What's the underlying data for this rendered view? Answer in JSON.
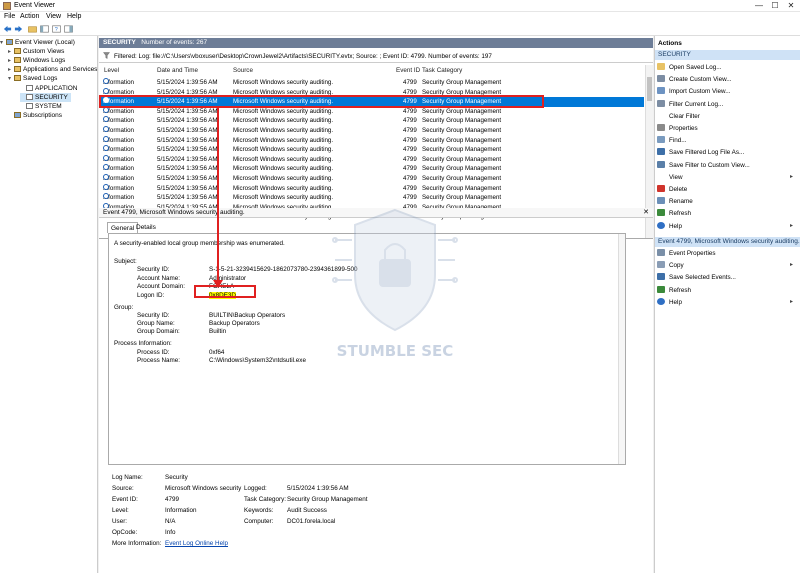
{
  "window": {
    "title": "Event Viewer",
    "controls": [
      "—",
      "☐",
      "✕"
    ]
  },
  "menu": [
    "File",
    "Action",
    "View",
    "Help"
  ],
  "tree": [
    {
      "label": "Event Viewer (Local)",
      "arrow": "v",
      "icon": "event-viewer-icon"
    },
    {
      "label": "Custom Views",
      "arrow": ">",
      "icon": "folder-icon"
    },
    {
      "label": "Windows Logs",
      "arrow": ">",
      "icon": "folder-icon"
    },
    {
      "label": "Applications and Services Lo",
      "arrow": ">",
      "icon": "folder-icon"
    },
    {
      "label": "Saved Logs",
      "arrow": "v",
      "icon": "folder-icon"
    },
    {
      "label": "APPLICATION",
      "arrow": "",
      "icon": "log-icon"
    },
    {
      "label": "SECURITY",
      "arrow": "",
      "icon": "log-icon"
    },
    {
      "label": "SYSTEM",
      "arrow": "",
      "icon": "log-icon"
    },
    {
      "label": "Subscriptions",
      "arrow": "",
      "icon": "subscriptions-icon"
    }
  ],
  "header": {
    "log": "SECURITY",
    "count": "Number of events: 267"
  },
  "filter": "Filtered: Log: file://C:\\Users\\vboxuser\\Desktop\\CrownJewel2\\Artifacts\\SECURITY.evtx; Source: ; Event ID: 4799. Number of events: 197",
  "columns": [
    "Level",
    "Date and Time",
    "Source",
    "Event ID",
    "Task Category"
  ],
  "rows": [
    {
      "level": "Information",
      "date": "5/15/2024 1:39:56 AM",
      "source": "Microsoft Windows security auditing.",
      "id": "4799",
      "task": "Security Group Management"
    },
    {
      "level": "Information",
      "date": "5/15/2024 1:39:56 AM",
      "source": "Microsoft Windows security auditing.",
      "id": "4799",
      "task": "Security Group Management"
    },
    {
      "level": "Information",
      "date": "5/15/2024 1:39:56 AM",
      "source": "Microsoft Windows security auditing.",
      "id": "4799",
      "task": "Security Group Management"
    },
    {
      "level": "Information",
      "date": "5/15/2024 1:39:56 AM",
      "source": "Microsoft Windows security auditing.",
      "id": "4799",
      "task": "Security Group Management"
    },
    {
      "level": "Information",
      "date": "5/15/2024 1:39:56 AM",
      "source": "Microsoft Windows security auditing.",
      "id": "4799",
      "task": "Security Group Management"
    },
    {
      "level": "Information",
      "date": "5/15/2024 1:39:56 AM",
      "source": "Microsoft Windows security auditing.",
      "id": "4799",
      "task": "Security Group Management"
    },
    {
      "level": "Information",
      "date": "5/15/2024 1:39:56 AM",
      "source": "Microsoft Windows security auditing.",
      "id": "4799",
      "task": "Security Group Management"
    },
    {
      "level": "Information",
      "date": "5/15/2024 1:39:56 AM",
      "source": "Microsoft Windows security auditing.",
      "id": "4799",
      "task": "Security Group Management"
    },
    {
      "level": "Information",
      "date": "5/15/2024 1:39:56 AM",
      "source": "Microsoft Windows security auditing.",
      "id": "4799",
      "task": "Security Group Management"
    },
    {
      "level": "Information",
      "date": "5/15/2024 1:39:56 AM",
      "source": "Microsoft Windows security auditing.",
      "id": "4799",
      "task": "Security Group Management"
    },
    {
      "level": "Information",
      "date": "5/15/2024 1:39:56 AM",
      "source": "Microsoft Windows security auditing.",
      "id": "4799",
      "task": "Security Group Management"
    },
    {
      "level": "Information",
      "date": "5/15/2024 1:39:56 AM",
      "source": "Microsoft Windows security auditing.",
      "id": "4799",
      "task": "Security Group Management"
    },
    {
      "level": "Information",
      "date": "5/15/2024 1:39:56 AM",
      "source": "Microsoft Windows security auditing.",
      "id": "4799",
      "task": "Security Group Management"
    },
    {
      "level": "Information",
      "date": "5/15/2024 1:39:55 AM",
      "source": "Microsoft Windows security auditing.",
      "id": "4799",
      "task": "Security Group Management"
    },
    {
      "level": "Information",
      "date": "5/15/2024 1:39:55 AM",
      "source": "Microsoft Windows security auditing.",
      "id": "4799",
      "task": "Security Group Management"
    }
  ],
  "selected_row": 2,
  "detail": {
    "header": "Event 4799, Microsoft Windows security auditing.",
    "tab_general": "General",
    "tab_details": "Details",
    "summary": "A security-enabled local group membership was enumerated.",
    "subject_label": "Subject:",
    "subject": [
      {
        "k": "Security ID:",
        "v": "S-1-5-21-3239415629-1862073780-2394361899-500"
      },
      {
        "k": "Account Name:",
        "v": "Administrator"
      },
      {
        "k": "Account Domain:",
        "v": "FORELA"
      },
      {
        "k": "Logon ID:",
        "v": "0x8DE3D"
      }
    ],
    "group_label": "Group:",
    "group": [
      {
        "k": "Security ID:",
        "v": "BUILTIN\\Backup Operators"
      },
      {
        "k": "Group Name:",
        "v": "Backup Operators"
      },
      {
        "k": "Group Domain:",
        "v": "Builtin"
      }
    ],
    "process_label": "Process Information:",
    "process": [
      {
        "k": "Process ID:",
        "v": "0xf64"
      },
      {
        "k": "Process Name:",
        "v": "C:\\Windows\\System32\\ntdsutil.exe"
      }
    ]
  },
  "properties": {
    "log_name_k": "Log Name:",
    "log_name": "Security",
    "source_k": "Source:",
    "source": "Microsoft Windows security",
    "logged_k": "Logged:",
    "logged": "5/15/2024 1:39:56 AM",
    "event_id_k": "Event ID:",
    "event_id": "4799",
    "task_k": "Task Category:",
    "task": "Security Group Management",
    "level_k": "Level:",
    "level": "Information",
    "keywords_k": "Keywords:",
    "keywords": "Audit Success",
    "user_k": "User:",
    "user": "N/A",
    "computer_k": "Computer:",
    "computer": "DC01.forela.local",
    "opcode_k": "OpCode:",
    "opcode": "Info",
    "more_k": "More Information:",
    "more": "Event Log Online Help"
  },
  "actions": {
    "title": "Actions",
    "section1": "SECURITY",
    "items1": [
      {
        "label": "Open Saved Log...",
        "icon": "open-log-icon"
      },
      {
        "label": "Create Custom View...",
        "icon": "filter-icon"
      },
      {
        "label": "Import Custom View...",
        "icon": "import-icon"
      },
      {
        "label": "Filter Current Log...",
        "icon": "filter-icon"
      },
      {
        "label": "Clear Filter",
        "icon": ""
      },
      {
        "label": "Properties",
        "icon": "properties-icon"
      },
      {
        "label": "Find...",
        "icon": "find-icon"
      },
      {
        "label": "Save Filtered Log File As...",
        "icon": "save-icon"
      },
      {
        "label": "Save Filter to Custom View...",
        "icon": "save-filter-icon"
      },
      {
        "label": "View",
        "icon": "",
        "sub": "▸"
      },
      {
        "label": "Delete",
        "icon": "delete-icon"
      },
      {
        "label": "Rename",
        "icon": "rename-icon"
      },
      {
        "label": "Refresh",
        "icon": "refresh-icon"
      },
      {
        "label": "Help",
        "icon": "help-icon",
        "sub": "▸"
      }
    ],
    "section2": "Event 4799, Microsoft Windows security auditing.",
    "items2": [
      {
        "label": "Event Properties",
        "icon": "event-properties-icon"
      },
      {
        "label": "Copy",
        "icon": "copy-icon",
        "sub": "▸"
      },
      {
        "label": "Save Selected Events...",
        "icon": "save-icon"
      },
      {
        "label": "Refresh",
        "icon": "refresh-icon"
      },
      {
        "label": "Help",
        "icon": "help-icon",
        "sub": "▸"
      }
    ]
  },
  "watermark": "STUMBLE SEC",
  "colors": {
    "selection": "#0078d7",
    "header": "#6d7d97",
    "highlight": "#e02020",
    "action_section": "#cfe2f6"
  }
}
